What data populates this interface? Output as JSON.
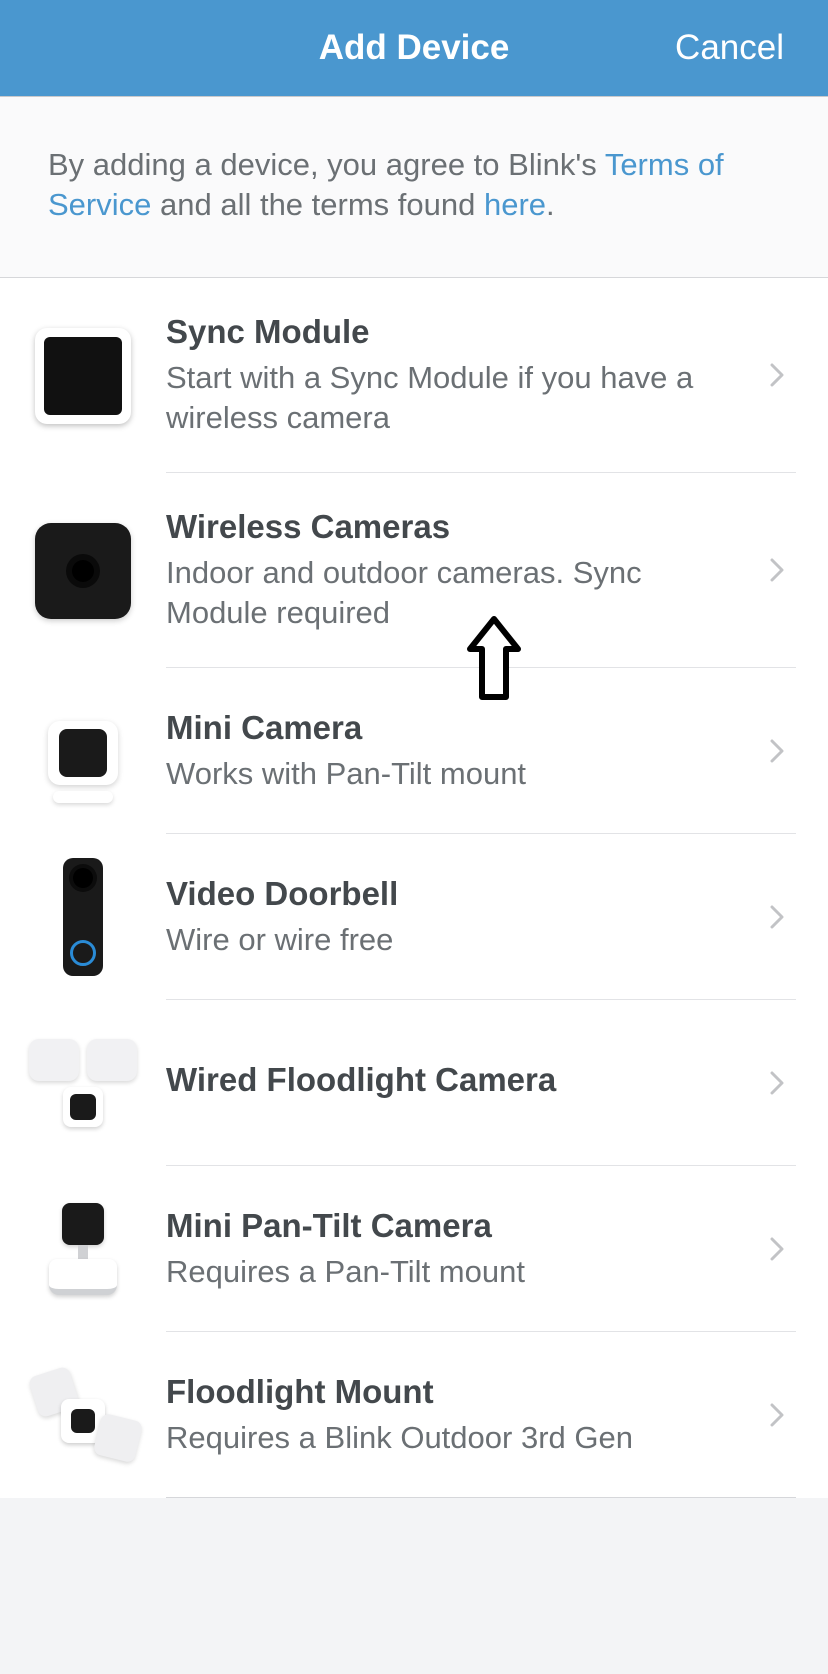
{
  "header": {
    "title": "Add Device",
    "cancel": "Cancel"
  },
  "intro": {
    "prefix": "By adding a device, you agree to Blink's ",
    "tos": "Terms of Service",
    "middle": " and all the terms found ",
    "here": "here",
    "suffix": "."
  },
  "devices": [
    {
      "icon": "sync-module",
      "title": "Sync Module",
      "subtitle": "Start with a Sync Module if you have a wireless camera"
    },
    {
      "icon": "wireless-cam",
      "title": "Wireless Cameras",
      "subtitle": "Indoor and outdoor cameras. Sync Module required"
    },
    {
      "icon": "mini-cam",
      "title": "Mini Camera",
      "subtitle": "Works with Pan-Tilt mount"
    },
    {
      "icon": "video-doorbell",
      "title": "Video Doorbell",
      "subtitle": "Wire or wire free"
    },
    {
      "icon": "wired-flood",
      "title": "Wired Floodlight Camera",
      "subtitle": ""
    },
    {
      "icon": "mini-pantilt",
      "title": "Mini Pan-Tilt Camera",
      "subtitle": "Requires a Pan-Tilt mount"
    },
    {
      "icon": "flood-mount",
      "title": "Floodlight Mount",
      "subtitle": "Requires a Blink Outdoor 3rd Gen"
    }
  ]
}
